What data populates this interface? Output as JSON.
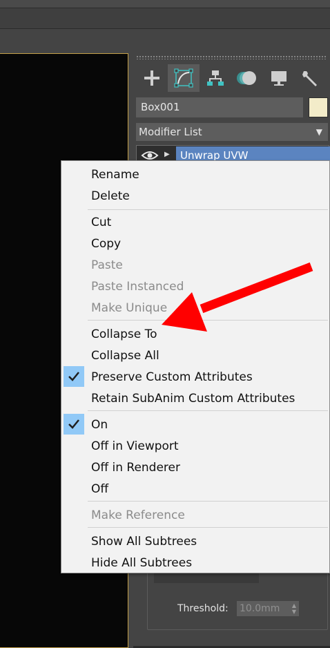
{
  "colors": {
    "accent": "#5b84c0",
    "viewport_border": "#c5a14a",
    "object_color": "#f3ecc9",
    "check_highlight": "#91c9f7",
    "annotation_arrow": "#ff0000"
  },
  "command_panel": {
    "tabs": [
      {
        "icon": "plus-icon"
      },
      {
        "icon": "modify-curve-icon"
      },
      {
        "icon": "hierarchy-icon"
      },
      {
        "icon": "motion-icon"
      },
      {
        "icon": "display-monitor-icon"
      },
      {
        "icon": "wrench-icon"
      }
    ],
    "object_name": "Box001",
    "modifier_list_label": "Modifier List",
    "stack_item": "Unwrap UVW",
    "threshold_label": "Threshold:",
    "threshold_value": "10.0mm"
  },
  "context_menu": {
    "group1": [
      {
        "label": "Rename",
        "enabled": true
      },
      {
        "label": "Delete",
        "enabled": true
      }
    ],
    "group2": [
      {
        "label": "Cut",
        "enabled": true
      },
      {
        "label": "Copy",
        "enabled": true
      },
      {
        "label": "Paste",
        "enabled": false
      },
      {
        "label": "Paste Instanced",
        "enabled": false
      },
      {
        "label": "Make Unique",
        "enabled": false
      }
    ],
    "group3": [
      {
        "label": "Collapse To",
        "enabled": true
      },
      {
        "label": "Collapse All",
        "enabled": true
      },
      {
        "label": "Preserve Custom Attributes",
        "enabled": true,
        "checked": true
      },
      {
        "label": "Retain SubAnim Custom Attributes",
        "enabled": true
      }
    ],
    "group4": [
      {
        "label": "On",
        "enabled": true,
        "checked": true
      },
      {
        "label": "Off in Viewport",
        "enabled": true
      },
      {
        "label": "Off in Renderer",
        "enabled": true
      },
      {
        "label": "Off",
        "enabled": true
      }
    ],
    "group5": [
      {
        "label": "Make Reference",
        "enabled": false
      }
    ],
    "group6": [
      {
        "label": "Show All Subtrees",
        "enabled": true
      },
      {
        "label": "Hide All Subtrees",
        "enabled": true
      }
    ]
  }
}
